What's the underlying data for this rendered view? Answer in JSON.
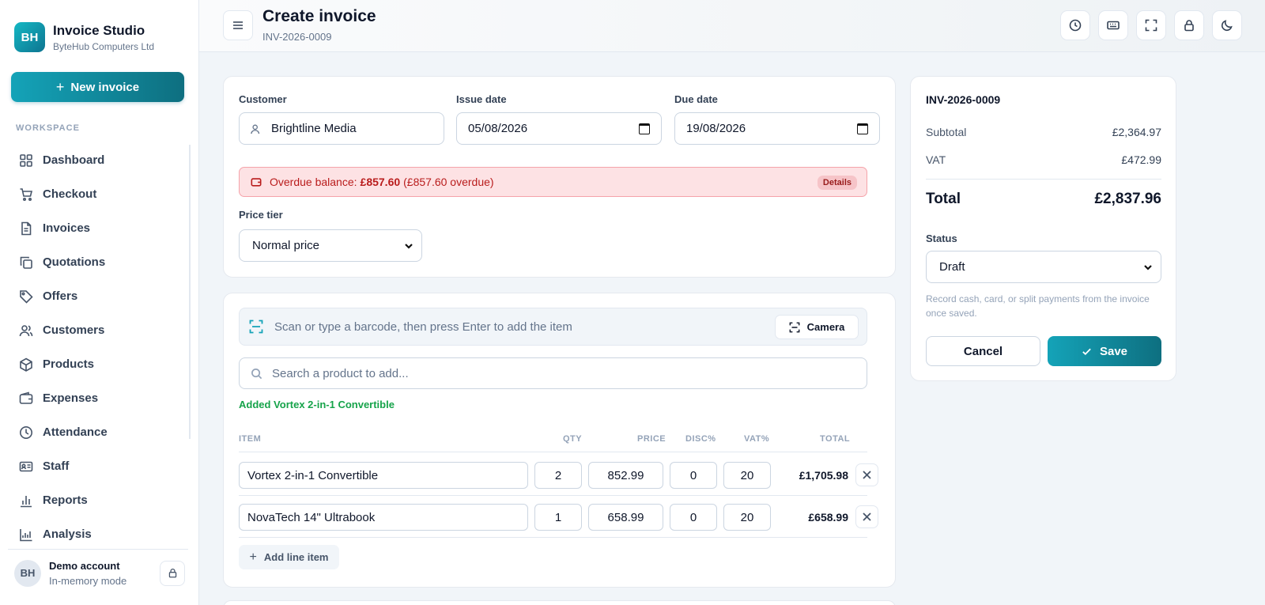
{
  "sidebar": {
    "brand": {
      "initials": "BH",
      "name": "Invoice Studio",
      "company": "ByteHub Computers Ltd"
    },
    "new_invoice_label": "New invoice",
    "section_label": "WORKSPACE",
    "items": [
      {
        "label": "Dashboard",
        "icon": "grid-icon"
      },
      {
        "label": "Checkout",
        "icon": "cart-icon"
      },
      {
        "label": "Invoices",
        "icon": "file-icon"
      },
      {
        "label": "Quotations",
        "icon": "copy-icon"
      },
      {
        "label": "Offers",
        "icon": "tag-icon"
      },
      {
        "label": "Customers",
        "icon": "users-icon"
      },
      {
        "label": "Products",
        "icon": "box-icon"
      },
      {
        "label": "Expenses",
        "icon": "wallet-icon"
      },
      {
        "label": "Attendance",
        "icon": "clock-icon"
      },
      {
        "label": "Staff",
        "icon": "id-card-icon"
      },
      {
        "label": "Reports",
        "icon": "bar-chart-icon"
      },
      {
        "label": "Analysis",
        "icon": "analytics-icon"
      }
    ],
    "account": {
      "initials": "BH",
      "name": "Demo account",
      "mode": "In-memory mode"
    }
  },
  "header": {
    "title": "Create invoice",
    "subtitle": "INV-2026-0009",
    "icons": [
      "history-icon",
      "keyboard-icon",
      "fullscreen-icon",
      "lock-icon",
      "moon-icon"
    ]
  },
  "form": {
    "customer_label": "Customer",
    "customer_value": "Brightline Media",
    "issue_label": "Issue date",
    "issue_value": "05/08/2026",
    "due_label": "Due date",
    "due_value": "19/08/2026",
    "alert": {
      "prefix": "Overdue balance:",
      "amount": "£857.60",
      "suffix": "(£857.60 overdue)",
      "details_label": "Details"
    },
    "price_tier_label": "Price tier",
    "price_tier_value": "Normal price"
  },
  "items_card": {
    "scan_placeholder": "Scan or type a barcode, then press Enter to add the item",
    "camera_label": "Camera",
    "search_placeholder": "Search a product to add...",
    "added_message": "Added Vortex 2-in-1 Convertible",
    "columns": {
      "item": "ITEM",
      "qty": "QTY",
      "price": "PRICE",
      "disc": "DISC%",
      "vat": "VAT%",
      "total": "TOTAL"
    },
    "rows": [
      {
        "item": "Vortex 2-in-1 Convertible",
        "qty": "2",
        "price": "852.99",
        "disc": "0",
        "vat": "20",
        "total": "£1,705.98"
      },
      {
        "item": "NovaTech 14\" Ultrabook",
        "qty": "1",
        "price": "658.99",
        "disc": "0",
        "vat": "20",
        "total": "£658.99"
      }
    ],
    "add_line_label": "Add line item"
  },
  "summary": {
    "invoice_id": "INV-2026-0009",
    "subtotal_label": "Subtotal",
    "subtotal_value": "£2,364.97",
    "vat_label": "VAT",
    "vat_value": "£472.99",
    "total_label": "Total",
    "total_value": "£2,837.96",
    "status_label": "Status",
    "status_value": "Draft",
    "hint": "Record cash, card, or split payments from the invoice once saved.",
    "cancel_label": "Cancel",
    "save_label": "Save"
  },
  "colors": {
    "accent": "#14a3b8",
    "accent_dark": "#0e6f80",
    "danger": "#b91c1c",
    "success": "#16a34a"
  }
}
